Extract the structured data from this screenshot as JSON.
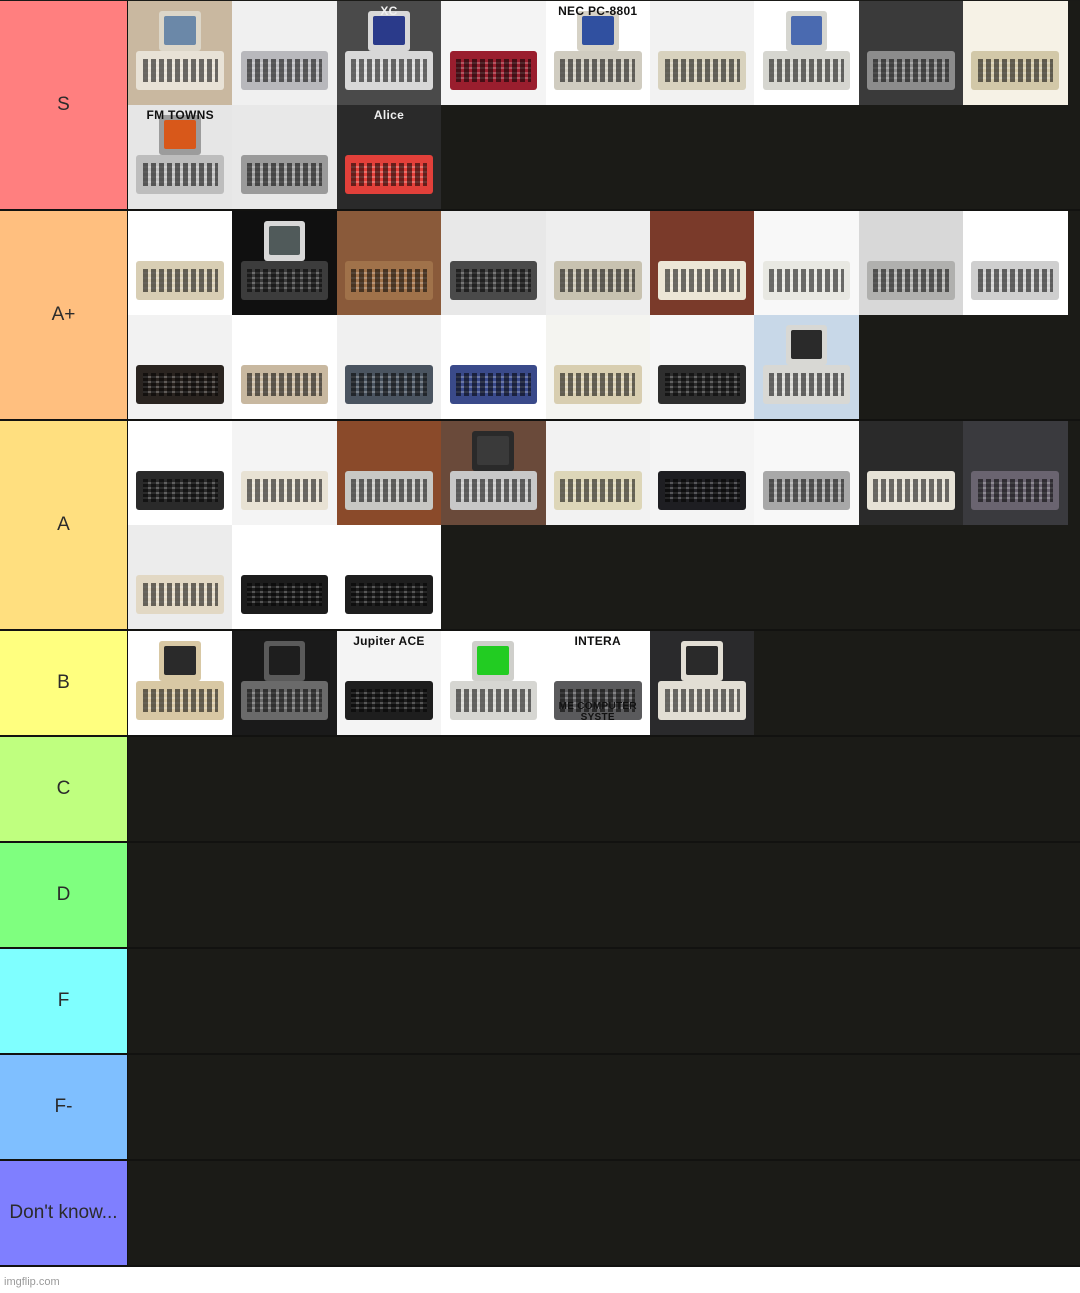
{
  "footer": {
    "watermark": "imgflip.com"
  },
  "colors": {
    "content_background": "#1b1b17",
    "divider": "#121210"
  },
  "tiers": [
    {
      "label": "S",
      "color": "#ff7f7f",
      "items": [
        {
          "name": "office-desk-computer",
          "bg": "#c9b8a0",
          "body": "#e8e2d6",
          "monitor": "#dcd6c8",
          "screen": "#6b88a8"
        },
        {
          "name": "silver-console-computer",
          "bg": "#f0f0f0",
          "body": "#b8b8bc",
          "monitor": null,
          "screen": null
        },
        {
          "name": "sharp-x68000",
          "bg": "#4a4a4a",
          "body": "#d8d8d8",
          "monitor": "#d8d8d8",
          "screen": "#2a3a8a",
          "caption": "XC"
        },
        {
          "name": "red-keyboard-computer",
          "bg": "#f4f4f4",
          "body": "#9a1e2e",
          "monitor": null,
          "screen": null
        },
        {
          "name": "nec-pc-8801",
          "bg": "#ffffff",
          "body": "#d0ccc0",
          "monitor": "#d6d2c6",
          "screen": "#3050a0",
          "caption": "NEC PC-8801"
        },
        {
          "name": "beige-keyboard-computer",
          "bg": "#f2f2f2",
          "body": "#d8d2be",
          "monitor": null,
          "screen": null
        },
        {
          "name": "amiga-style-computer",
          "bg": "#ffffff",
          "body": "#d6d6d0",
          "monitor": "#d6d6d0",
          "screen": "#4a6ab0"
        },
        {
          "name": "grey-red-keys-computer",
          "bg": "#3a3a3a",
          "body": "#8c8c8c",
          "monitor": null,
          "screen": null
        },
        {
          "name": "cream-keyboard-computer",
          "bg": "#f6f2e6",
          "body": "#d2c8a8",
          "monitor": null,
          "screen": null
        },
        {
          "name": "fm-towns",
          "bg": "#e6e6e6",
          "body": "#bdbdbd",
          "monitor": "#9c9c9c",
          "screen": "#d8581a",
          "caption": "FM TOWNS"
        },
        {
          "name": "grey-wedge-computer",
          "bg": "#e8e8e8",
          "body": "#9a9a9a",
          "monitor": null,
          "screen": null
        },
        {
          "name": "red-alice-computer",
          "bg": "#2a2a2a",
          "body": "#e2403a",
          "monitor": null,
          "screen": null,
          "caption": "Alice"
        }
      ]
    },
    {
      "label": "A+",
      "color": "#ffbf7f",
      "items": [
        {
          "name": "c64-style-computer",
          "bg": "#ffffff",
          "body": "#d8ceb4",
          "monitor": null,
          "screen": null
        },
        {
          "name": "black-computer-crt",
          "bg": "#101010",
          "body": "#3c3c3c",
          "monitor": "#d8d8d8",
          "screen": "#505a5a"
        },
        {
          "name": "wooden-case-computer",
          "bg": "#8a5a3a",
          "body": "#a0724a",
          "monitor": null,
          "screen": null
        },
        {
          "name": "dark-grey-keyboard",
          "bg": "#e8e8e8",
          "body": "#4a4a4a",
          "monitor": null,
          "screen": null
        },
        {
          "name": "bbc-style-micro",
          "bg": "#eeeeee",
          "body": "#c8c2b0",
          "monitor": null,
          "screen": null
        },
        {
          "name": "cream-white-computer",
          "bg": "#7a3a2a",
          "body": "#ece6d6",
          "monitor": null,
          "screen": null
        },
        {
          "name": "white-keyboard-computer",
          "bg": "#f8f8f8",
          "body": "#e8e8e2",
          "monitor": null,
          "screen": null
        },
        {
          "name": "grey-calculator-computer",
          "bg": "#d8d8d8",
          "body": "#b0b0ae",
          "monitor": null,
          "screen": null
        },
        {
          "name": "silver-black-keyboard",
          "bg": "#ffffff",
          "body": "#cfcfcf",
          "monitor": null,
          "screen": null
        },
        {
          "name": "black-red-console",
          "bg": "#f2f2f2",
          "body": "#2a2420",
          "monitor": null,
          "screen": null
        },
        {
          "name": "brown-keys-computer",
          "bg": "#ffffff",
          "body": "#c8b8a0",
          "monitor": null,
          "screen": null
        },
        {
          "name": "slate-keyboard",
          "bg": "#f0f0f0",
          "body": "#4a5460",
          "monitor": null,
          "screen": null
        },
        {
          "name": "blue-keys-computer",
          "bg": "#ffffff",
          "body": "#3a4a8a",
          "monitor": null,
          "screen": null
        },
        {
          "name": "beige-blue-keys-computer",
          "bg": "#f4f4f0",
          "body": "#d8ceb0",
          "monitor": null,
          "screen": null
        },
        {
          "name": "black-keys-beige-computer",
          "bg": "#f6f6f6",
          "body": "#2e2e2e",
          "monitor": null,
          "screen": null
        },
        {
          "name": "macintosh-style-computer",
          "bg": "#c8d8e8",
          "body": "#d8d8d4",
          "monitor": "#d8d8d4",
          "screen": "#2a2a2a"
        }
      ]
    },
    {
      "label": "A",
      "color": "#ffdf7f",
      "items": [
        {
          "name": "ti-99-4a",
          "bg": "#ffffff",
          "body": "#2a2a2a",
          "monitor": null,
          "screen": null
        },
        {
          "name": "black-keys-white-computer",
          "bg": "#f4f4f4",
          "body": "#e8e2d4",
          "monitor": null,
          "screen": null
        },
        {
          "name": "silver-wedge-brown-bg",
          "bg": "#8a4a2a",
          "body": "#c8c8c4",
          "monitor": null,
          "screen": null
        },
        {
          "name": "computer-with-crt-monitor",
          "bg": "#6a4a3a",
          "body": "#c8c8c8",
          "monitor": "#2a2a2a",
          "screen": "#3a3a3a"
        },
        {
          "name": "beige-laptop-style",
          "bg": "#f2f2f2",
          "body": "#ddd6b8",
          "monitor": null,
          "screen": null
        },
        {
          "name": "black-keyboard-computer",
          "bg": "#f4f4f4",
          "body": "#1e1e22",
          "monitor": null,
          "screen": null
        },
        {
          "name": "grey-long-keyboard",
          "bg": "#f8f8f8",
          "body": "#a8a8a8",
          "monitor": null,
          "screen": null
        },
        {
          "name": "white-keys-black-computer",
          "bg": "#2a2a2a",
          "body": "#e6e2d6",
          "monitor": null,
          "screen": null
        },
        {
          "name": "dark-purple-keyboard",
          "bg": "#3a3a3e",
          "body": "#6a6470",
          "monitor": null,
          "screen": null
        },
        {
          "name": "cream-dual-drive-computer",
          "bg": "#ececec",
          "body": "#e2d8c4",
          "monitor": null,
          "screen": null
        },
        {
          "name": "zx81",
          "bg": "#ffffff",
          "body": "#1c1c1c",
          "monitor": null,
          "screen": null
        },
        {
          "name": "zx-spectrum",
          "bg": "#ffffff",
          "body": "#1e1e1e",
          "monitor": null,
          "screen": null
        }
      ]
    },
    {
      "label": "B",
      "color": "#ffff7f",
      "items": [
        {
          "name": "apple-ii",
          "bg": "#ffffff",
          "body": "#d8c8a4",
          "monitor": "#d8c8a4",
          "screen": "#2a2a2a"
        },
        {
          "name": "dark-terminal-computer",
          "bg": "#1a1a1a",
          "body": "#6a6a6a",
          "monitor": "#5a5a5a",
          "screen": "#1e1e1e"
        },
        {
          "name": "jupiter-ace",
          "bg": "#f4f4f4",
          "body": "#1e1e1e",
          "monitor": null,
          "screen": null,
          "caption": "Jupiter ACE"
        },
        {
          "name": "atari-st",
          "bg": "#ffffff",
          "body": "#d6d6d2",
          "monitor": "#cfcfcb",
          "screen": "#22cc22"
        },
        {
          "name": "interact-home-computer",
          "bg": "#ffffff",
          "body": "#5a5a5c",
          "monitor": null,
          "screen": null,
          "caption": "INTERA",
          "caption_bottom": "ME COMPUTER SYSTE"
        },
        {
          "name": "commodore-pet",
          "bg": "#2a2a2c",
          "body": "#e2ded4",
          "monitor": "#e2ded4",
          "screen": "#2a2a2a"
        }
      ]
    },
    {
      "label": "C",
      "color": "#bfff7f",
      "items": []
    },
    {
      "label": "D",
      "color": "#7fff7f",
      "items": []
    },
    {
      "label": "F",
      "color": "#7fffff",
      "items": []
    },
    {
      "label": "F-",
      "color": "#7fbfff",
      "items": []
    },
    {
      "label": "Don't know...",
      "color": "#7f7fff",
      "items": []
    }
  ]
}
